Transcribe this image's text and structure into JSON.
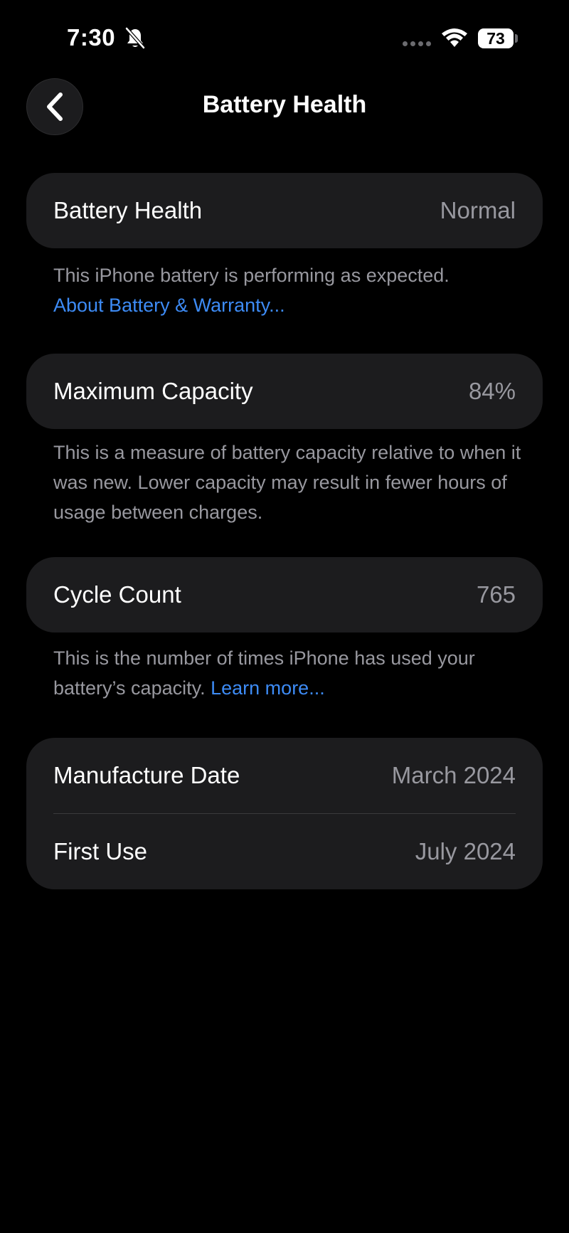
{
  "status_bar": {
    "time": "7:30",
    "battery_level": "73",
    "icons": [
      "bell-slash-icon",
      "cellular-dots-icon",
      "wifi-icon",
      "battery-icon"
    ]
  },
  "nav": {
    "back_icon": "chevron-left-icon",
    "title": "Battery Health"
  },
  "battery_health": {
    "label": "Battery Health",
    "value": "Normal",
    "footnote": "This iPhone battery is performing as expected.",
    "link": "About Battery & Warranty..."
  },
  "maximum_capacity": {
    "label": "Maximum Capacity",
    "value": "84%",
    "footnote": "This is a measure of battery capacity relative to when it was new. Lower capacity may result in fewer hours of usage between charges."
  },
  "cycle_count": {
    "label": "Cycle Count",
    "value": "765",
    "footnote": "This is the number of times iPhone has used your battery’s capacity.",
    "link": "Learn more..."
  },
  "dates": {
    "manufacture_label": "Manufacture Date",
    "manufacture_value": "March 2024",
    "first_use_label": "First Use",
    "first_use_value": "July 2024"
  },
  "colors": {
    "background": "#000000",
    "card": "#1c1c1e",
    "secondary_text": "#98989f",
    "link": "#3d8bf5"
  }
}
